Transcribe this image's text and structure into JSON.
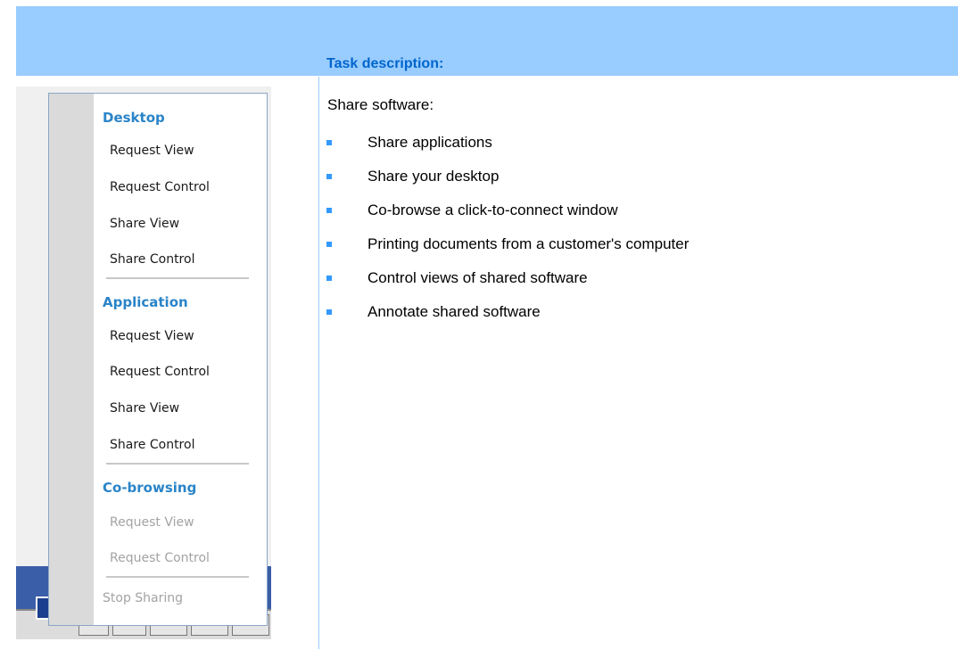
{
  "task": {
    "heading": "Task description:",
    "intro": "Share software:",
    "items": [
      "Share applications",
      "Share your desktop",
      "Co-browse a click-to-connect window",
      "Printing documents from a customer's computer",
      "Control views of shared software",
      "Annotate shared software"
    ]
  },
  "menu": {
    "desktop": {
      "title": "Desktop",
      "items": [
        "Request View",
        "Request Control",
        "Share View",
        "Share Control"
      ]
    },
    "application": {
      "title": "Application",
      "items": [
        "Request View",
        "Request Control",
        "Share View",
        "Share Control"
      ]
    },
    "cobrowsing": {
      "title": "Co-browsing",
      "items": [
        "Request View",
        "Request Control"
      ]
    },
    "stop": "Stop Sharing"
  },
  "colors": {
    "header": "#99ccff",
    "heading": "#0066cc",
    "bullet": "#3399ff",
    "section": "#2a84c8"
  }
}
